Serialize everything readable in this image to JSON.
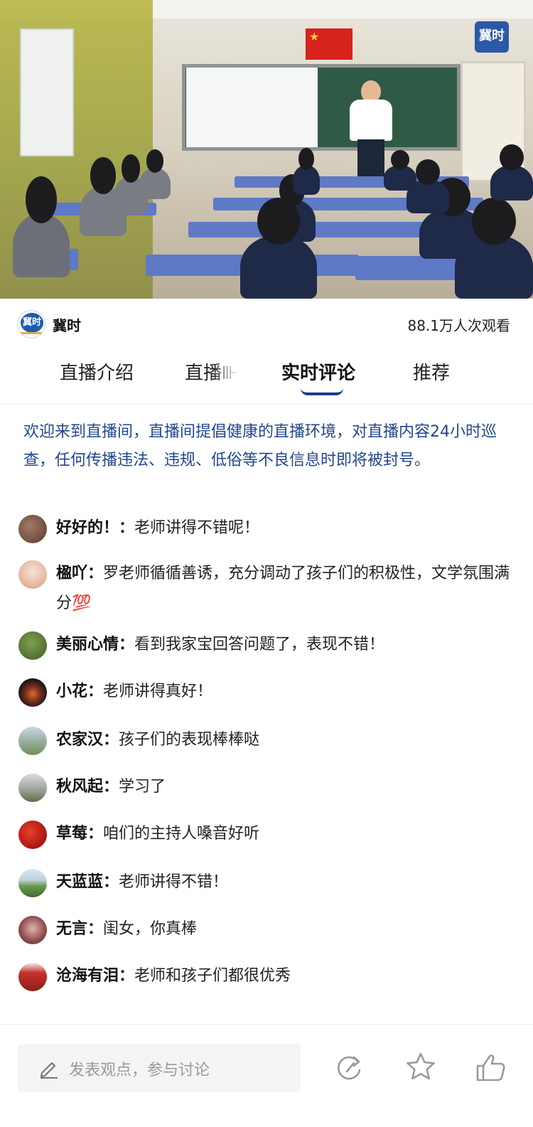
{
  "video": {
    "logo_text": "冀时"
  },
  "channel": {
    "name": "冀时",
    "logo_text": "冀时",
    "views": "88.1万人次观看"
  },
  "tabs": [
    {
      "label": "直播介绍",
      "active": false
    },
    {
      "label": "直播⊪",
      "active": false
    },
    {
      "label": "实时评论",
      "active": true
    },
    {
      "label": "推荐",
      "active": false
    }
  ],
  "notice": "欢迎来到直播间，直播间提倡健康的直播环境，对直播内容24小时巡查，任何传播违法、违规、低俗等不良信息时即将被封号。",
  "comments": [
    {
      "user": "好好的！：",
      "text": "老师讲得不错呢！"
    },
    {
      "user": "楹吖：",
      "text": "罗老师循循善诱，充分调动了孩子们的积极性，文学氛围满分💯"
    },
    {
      "user": "美丽心情：",
      "text": "看到我家宝回答问题了，表现不错！"
    },
    {
      "user": "小花：",
      "text": "老师讲得真好！"
    },
    {
      "user": "农家汉：",
      "text": "孩子们的表现棒棒哒"
    },
    {
      "user": "秋风起：",
      "text": "学习了"
    },
    {
      "user": "草莓：",
      "text": "咱们的主持人嗓音好听"
    },
    {
      "user": "天蓝蓝：",
      "text": "老师讲得不错！"
    },
    {
      "user": "无言：",
      "text": "闺女，你真棒"
    },
    {
      "user": "沧海有泪：",
      "text": "老师和孩子们都很优秀"
    }
  ],
  "input": {
    "placeholder": "发表观点，参与讨论"
  },
  "actions": [
    {
      "icon": "share-icon"
    },
    {
      "icon": "star-icon"
    },
    {
      "icon": "like-icon"
    }
  ],
  "colors": {
    "notice_text": "#22478f",
    "tab_indicator": "#1a3e8e",
    "icon_gray": "#9a9a9a"
  }
}
